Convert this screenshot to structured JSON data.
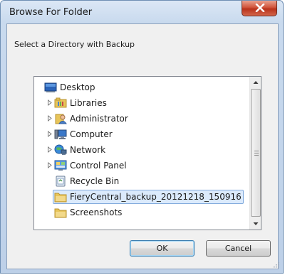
{
  "window": {
    "title": "Browse For Folder"
  },
  "dialog": {
    "description": "Select a Directory with Backup"
  },
  "tree": {
    "items": [
      {
        "label": "Desktop",
        "icon": "desktop-icon",
        "expandable": false
      },
      {
        "label": "Libraries",
        "icon": "libraries-icon",
        "expandable": true
      },
      {
        "label": "Administrator",
        "icon": "user-icon",
        "expandable": true
      },
      {
        "label": "Computer",
        "icon": "computer-icon",
        "expandable": true
      },
      {
        "label": "Network",
        "icon": "network-icon",
        "expandable": true
      },
      {
        "label": "Control Panel",
        "icon": "control-panel-icon",
        "expandable": true
      },
      {
        "label": "Recycle Bin",
        "icon": "recycle-bin-icon",
        "expandable": false
      },
      {
        "label": "FieryCentral_backup_20121218_150916",
        "icon": "folder-icon",
        "expandable": false,
        "selected": true
      },
      {
        "label": "Screenshots",
        "icon": "folder-icon",
        "expandable": false
      }
    ]
  },
  "buttons": {
    "ok": "OK",
    "cancel": "Cancel"
  },
  "colors": {
    "selection": "#dbeafc",
    "selection_border": "#84acdd",
    "close_button": "#c7402a"
  }
}
